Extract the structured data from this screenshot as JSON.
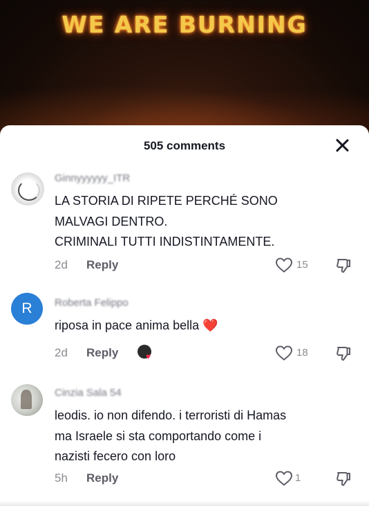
{
  "video": {
    "title": "WE ARE BURNING"
  },
  "sheet": {
    "comments_count": "505 comments"
  },
  "comments": [
    {
      "username": "Ginnyyyyyy_ITR",
      "text_lines": [
        "LA STORIA DI RIPETE PERCHÉ SONO",
        "MALVAGI DENTRO.",
        "CRIMINALI TUTTI INDISTINTAMENTE."
      ],
      "time": "2d",
      "reply_label": "Reply",
      "likes": "15"
    },
    {
      "avatar_letter": "R",
      "username": "Roberta Felippo",
      "text_lines": [
        "riposa in pace anima bella ❤️"
      ],
      "time": "2d",
      "reply_label": "Reply",
      "likes": "18",
      "creator_liked": true
    },
    {
      "username": "Cinzia Sala 54",
      "text_lines": [
        "leodis. io non difendo. i terroristi di Hamas",
        "ma Israele si sta comportando come i",
        "nazisti fecero con loro"
      ],
      "time": "5h",
      "reply_label": "Reply",
      "likes": "1"
    }
  ],
  "colors": {
    "primary_text": "#161823",
    "secondary_text": "#8a8b91",
    "avatar_blue": "#2a7fd6",
    "heart_red": "#fe2c55"
  }
}
